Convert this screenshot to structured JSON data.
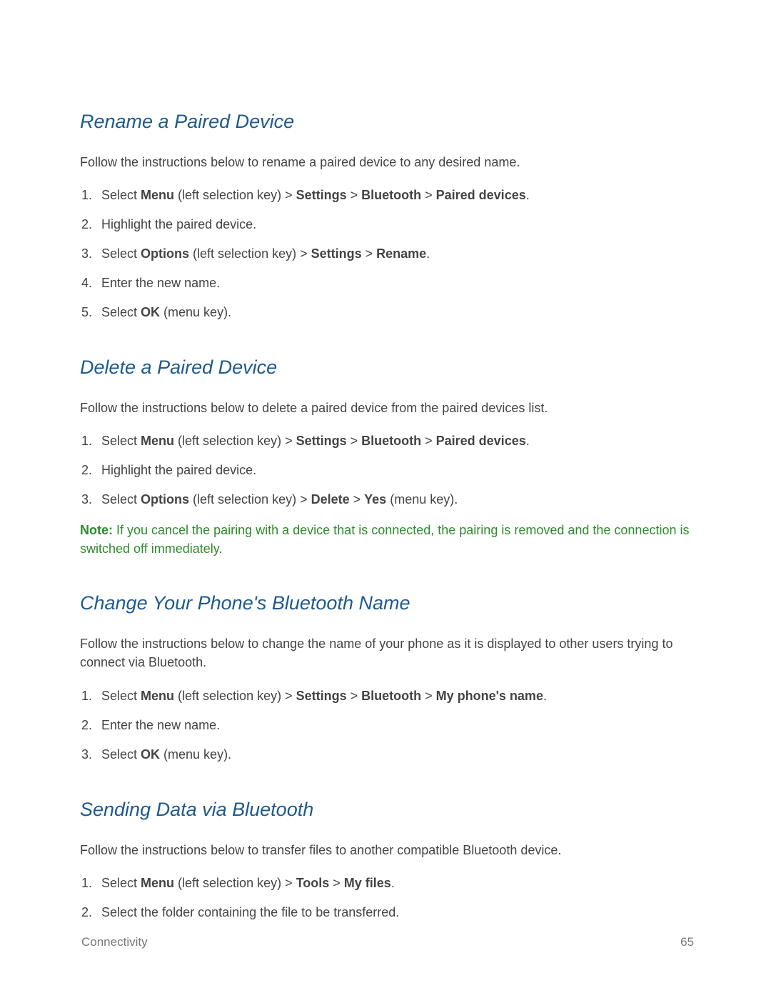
{
  "sections": [
    {
      "title": "Rename a Paired Device",
      "intro": "Follow the instructions below to rename a paired device to any desired name.",
      "steps": [
        {
          "parts": [
            {
              "t": "Select "
            },
            {
              "t": "Menu",
              "b": true
            },
            {
              "t": " (left selection key) > "
            },
            {
              "t": "Settings",
              "b": true
            },
            {
              "t": " > "
            },
            {
              "t": "Bluetooth",
              "b": true
            },
            {
              "t": " > "
            },
            {
              "t": "Paired devices",
              "b": true
            },
            {
              "t": "."
            }
          ]
        },
        {
          "parts": [
            {
              "t": "Highlight the paired device."
            }
          ]
        },
        {
          "parts": [
            {
              "t": "Select "
            },
            {
              "t": "Options",
              "b": true
            },
            {
              "t": " (left selection key) > "
            },
            {
              "t": "Settings",
              "b": true
            },
            {
              "t": " > "
            },
            {
              "t": "Rename",
              "b": true
            },
            {
              "t": "."
            }
          ]
        },
        {
          "parts": [
            {
              "t": "Enter the new name."
            }
          ]
        },
        {
          "parts": [
            {
              "t": "Select "
            },
            {
              "t": "OK",
              "b": true
            },
            {
              "t": " (menu key)."
            }
          ]
        }
      ]
    },
    {
      "title": "Delete a Paired Device",
      "intro": "Follow the instructions below to delete a paired device from the paired devices list.",
      "steps": [
        {
          "parts": [
            {
              "t": "Select "
            },
            {
              "t": "Menu",
              "b": true
            },
            {
              "t": " (left selection key) > "
            },
            {
              "t": "Settings",
              "b": true
            },
            {
              "t": " > "
            },
            {
              "t": "Bluetooth",
              "b": true
            },
            {
              "t": " > "
            },
            {
              "t": "Paired devices",
              "b": true
            },
            {
              "t": "."
            }
          ]
        },
        {
          "parts": [
            {
              "t": "Highlight the paired device."
            }
          ]
        },
        {
          "parts": [
            {
              "t": "Select "
            },
            {
              "t": "Options",
              "b": true
            },
            {
              "t": " (left selection key) > "
            },
            {
              "t": "Delete",
              "b": true
            },
            {
              "t": " > "
            },
            {
              "t": "Yes",
              "b": true
            },
            {
              "t": " (menu key)."
            }
          ]
        }
      ],
      "note": {
        "label": "Note:",
        "text": " If you cancel the pairing with a device that is connected, the pairing is removed and the connection is switched off immediately."
      }
    },
    {
      "title": "Change Your Phone's Bluetooth Name",
      "intro": "Follow the instructions below to change the name of your phone as it is displayed to other users trying to connect via Bluetooth.",
      "steps": [
        {
          "parts": [
            {
              "t": "Select "
            },
            {
              "t": "Menu",
              "b": true
            },
            {
              "t": " (left selection key) > "
            },
            {
              "t": "Settings",
              "b": true
            },
            {
              "t": " > "
            },
            {
              "t": "Bluetooth",
              "b": true
            },
            {
              "t": " > "
            },
            {
              "t": "My phone's name",
              "b": true
            },
            {
              "t": "."
            }
          ]
        },
        {
          "parts": [
            {
              "t": "Enter the new name."
            }
          ]
        },
        {
          "parts": [
            {
              "t": "Select "
            },
            {
              "t": "OK",
              "b": true
            },
            {
              "t": " (menu key)."
            }
          ]
        }
      ]
    },
    {
      "title": "Sending Data via Bluetooth",
      "intro": "Follow the instructions below to transfer files to another compatible Bluetooth device.",
      "steps": [
        {
          "parts": [
            {
              "t": "Select "
            },
            {
              "t": "Menu",
              "b": true
            },
            {
              "t": " (left selection key) > "
            },
            {
              "t": "Tools",
              "b": true
            },
            {
              "t": " > "
            },
            {
              "t": "My files",
              "b": true
            },
            {
              "t": "."
            }
          ]
        },
        {
          "parts": [
            {
              "t": "Select the folder containing the file to be transferred."
            }
          ]
        }
      ]
    }
  ],
  "footer": {
    "section": "Connectivity",
    "page": "65"
  }
}
